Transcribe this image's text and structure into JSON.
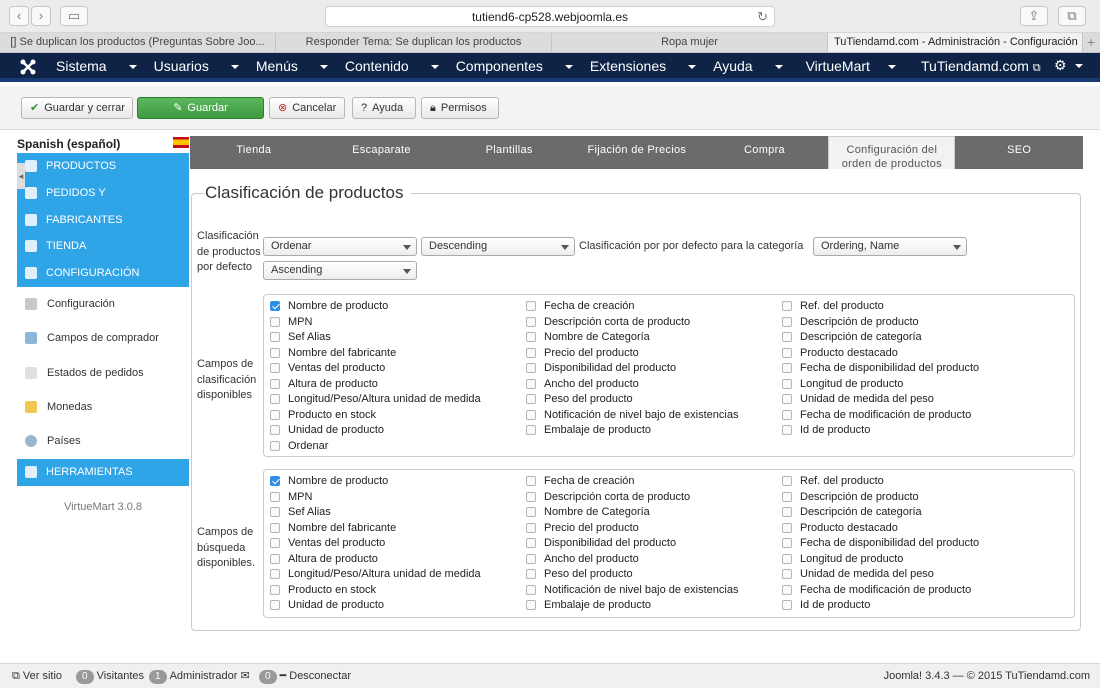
{
  "browser": {
    "url": "tutiend6-cp528.webjoomla.es",
    "tabs": [
      "[] Se duplican los productos (Preguntas Sobre Joo...",
      "Responder Tema: Se duplican los productos",
      "Ropa mujer",
      "TuTiendamd.com - Administración - Configuración"
    ]
  },
  "nav": {
    "menu": [
      "Sistema",
      "Usuarios",
      "Menús",
      "Contenido",
      "Componentes",
      "Extensiones",
      "Ayuda",
      "VirtueMart"
    ],
    "site": "TuTiendamd.com"
  },
  "toolbar": {
    "save_close": "Guardar y cerrar",
    "save": "Guardar",
    "cancel": "Cancelar",
    "help": "Ayuda",
    "permissions": "Permisos"
  },
  "sidebar": {
    "language": "Spanish (español)",
    "groups": [
      "PRODUCTOS",
      "PEDIDOS Y",
      "FABRICANTES",
      "TIENDA",
      "CONFIGURACIÓN",
      "HERRAMIENTAS"
    ],
    "items": [
      "Configuración",
      "Campos de comprador",
      "Estados de pedidos",
      "Monedas",
      "Países"
    ],
    "version": "VirtueMart 3.0.8"
  },
  "tabs": [
    "Tienda",
    "Escaparate",
    "Plantillas",
    "Fijación de Precios",
    "Compra",
    "Configuración del orden de productos",
    "SEO"
  ],
  "section": {
    "title": "Clasificación de productos",
    "default_label": "Clasificación de productos por defecto",
    "select_order": "Ordenar",
    "select_dir": "Descending",
    "category_label": "Clasificación por por defecto para la categoría",
    "select_cat_order": "Ordering, Name",
    "select_cat_dir": "Ascending",
    "sort_label": "Campos de clasificación disponibles",
    "search_label": "Campos de búsqueda disponibles."
  },
  "sort_fields": {
    "col1": [
      "Nombre de producto",
      "MPN",
      "Sef Alias",
      "Nombre del fabricante",
      "Ventas del producto",
      "Altura de producto",
      "Longitud/Peso/Altura unidad de medida",
      "Producto en stock",
      "Unidad de producto",
      "Ordenar"
    ],
    "col2": [
      "Fecha de creación",
      "Descripción corta de producto",
      "Nombre de Categoría",
      "Precio del producto",
      "Disponibilidad del producto",
      "Ancho del producto",
      "Peso del producto",
      "Notificación de nivel bajo de existencias",
      "Embalaje de producto"
    ],
    "col3": [
      "Ref. del producto",
      "Descripción de producto",
      "Descripción de categoría",
      "Producto destacado",
      "Fecha de disponibilidad del producto",
      "Longitud de producto",
      "Unidad de medida del peso",
      "Fecha de modificación de producto",
      "Id de producto"
    ]
  },
  "search_fields": {
    "col1": [
      "Nombre de producto",
      "MPN",
      "Sef Alias",
      "Nombre del fabricante",
      "Ventas del producto",
      "Altura de producto",
      "Longitud/Peso/Altura unidad de medida",
      "Producto en stock",
      "Unidad de producto"
    ],
    "col2": [
      "Fecha de creación",
      "Descripción corta de producto",
      "Nombre de Categoría",
      "Precio del producto",
      "Disponibilidad del producto",
      "Ancho del producto",
      "Peso del producto",
      "Notificación de nivel bajo de existencias",
      "Embalaje de producto"
    ],
    "col3": [
      "Ref. del producto",
      "Descripción de producto",
      "Descripción de categoría",
      "Producto destacado",
      "Fecha de disponibilidad del producto",
      "Longitud de producto",
      "Unidad de medida del peso",
      "Fecha de modificación de producto",
      "Id de producto"
    ]
  },
  "footer": {
    "view_site": "Ver sitio",
    "visitors_count": "0",
    "visitors": "Visitantes",
    "admins_count": "1",
    "admin": "Administrador",
    "messages_count": "0",
    "logout": "Desconectar",
    "right": "Joomla! 3.4.3  —  © 2015 TuTiendamd.com"
  }
}
